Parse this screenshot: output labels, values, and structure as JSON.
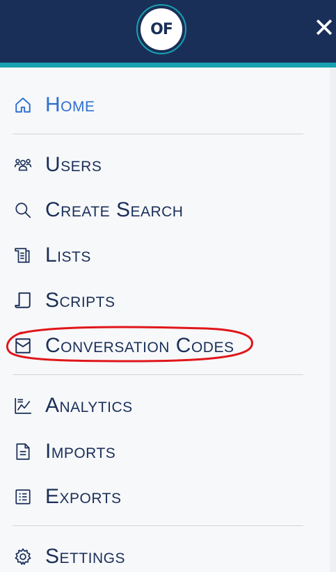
{
  "header": {
    "logo_text": "OF",
    "close_symbol": "✕",
    "colors": {
      "bar": "#1a2f58",
      "accent": "#16a2b0"
    }
  },
  "nav": {
    "items": [
      {
        "label": "Home",
        "icon": "home-icon",
        "active": true
      },
      {
        "label": "Users",
        "icon": "users-icon"
      },
      {
        "label": "Create Search",
        "icon": "search-icon"
      },
      {
        "label": "Lists",
        "icon": "list-icon"
      },
      {
        "label": "Scripts",
        "icon": "scroll-icon"
      },
      {
        "label": "Conversation Codes",
        "icon": "envelope-icon",
        "highlighted": true
      },
      {
        "label": "Analytics",
        "icon": "chart-icon"
      },
      {
        "label": "Imports",
        "icon": "document-icon"
      },
      {
        "label": "Exports",
        "icon": "ledger-icon"
      },
      {
        "label": "Settings",
        "icon": "gear-icon"
      }
    ]
  },
  "colors": {
    "active_text": "#2e6fd1",
    "text": "#1a2f58",
    "highlight": "#e0161a"
  }
}
